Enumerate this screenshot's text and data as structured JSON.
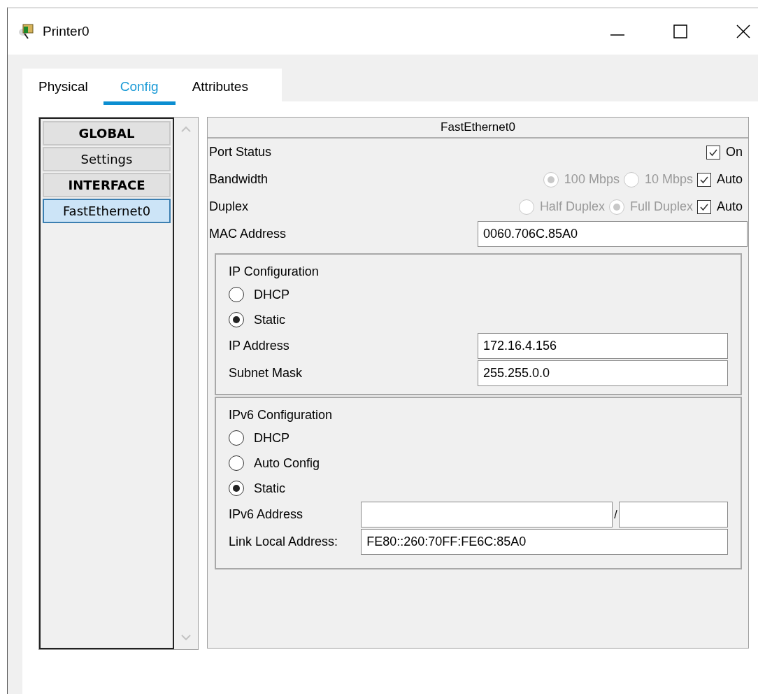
{
  "window": {
    "title": "Printer0"
  },
  "tabs": [
    {
      "label": "Physical",
      "selected": false
    },
    {
      "label": "Config",
      "selected": true
    },
    {
      "label": "Attributes",
      "selected": false
    }
  ],
  "sidebar": {
    "items": [
      {
        "label": "GLOBAL",
        "kind": "header",
        "selected": false
      },
      {
        "label": "Settings",
        "kind": "item",
        "selected": false
      },
      {
        "label": "INTERFACE",
        "kind": "header",
        "selected": false
      },
      {
        "label": "FastEthernet0",
        "kind": "item",
        "selected": true
      }
    ]
  },
  "interface": {
    "title": "FastEthernet0",
    "port_status": {
      "label": "Port Status",
      "toggle": {
        "label": "On",
        "checked": true
      }
    },
    "bandwidth": {
      "label": "Bandwidth",
      "disabled": true,
      "options": [
        {
          "label": "100 Mbps",
          "selected": true
        },
        {
          "label": "10 Mbps",
          "selected": false
        }
      ],
      "auto": {
        "label": "Auto",
        "checked": true
      }
    },
    "duplex": {
      "label": "Duplex",
      "disabled": true,
      "options": [
        {
          "label": "Half Duplex",
          "selected": false
        },
        {
          "label": "Full Duplex",
          "selected": true
        }
      ],
      "auto": {
        "label": "Auto",
        "checked": true
      }
    },
    "mac_address": {
      "label": "MAC Address",
      "value": "0060.706C.85A0"
    },
    "ip_configuration": {
      "title": "IP Configuration",
      "modes": [
        {
          "label": "DHCP",
          "selected": false
        },
        {
          "label": "Static",
          "selected": true
        }
      ],
      "fields": [
        {
          "label": "IP Address",
          "value": "172.16.4.156"
        },
        {
          "label": "Subnet Mask",
          "value": "255.255.0.0"
        }
      ]
    },
    "ipv6_configuration": {
      "title": "IPv6 Configuration",
      "modes": [
        {
          "label": "DHCP",
          "selected": false
        },
        {
          "label": "Auto Config",
          "selected": false
        },
        {
          "label": "Static",
          "selected": true
        }
      ],
      "address": {
        "label": "IPv6 Address",
        "separator": "/"
      },
      "link_local": {
        "label": "Link Local Address:",
        "value": "FE80::260:70FF:FE6C:85A0"
      }
    }
  }
}
